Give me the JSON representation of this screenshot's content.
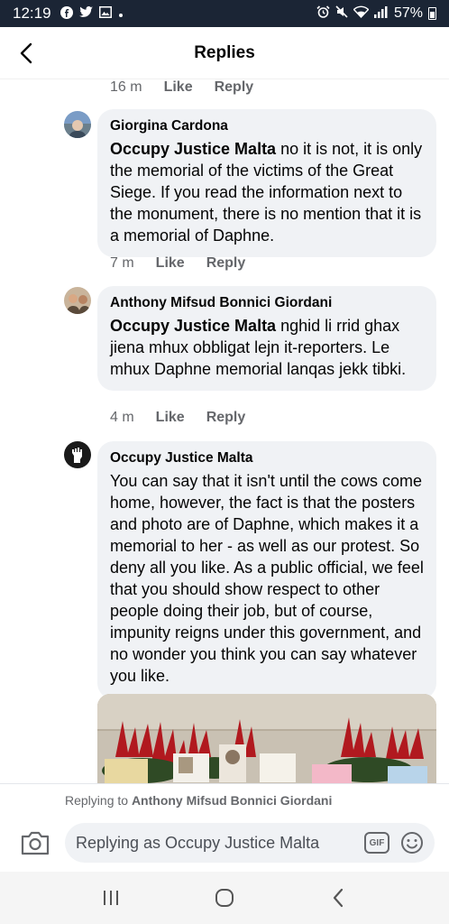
{
  "status_bar": {
    "time": "12:19",
    "battery": "57%",
    "icons": [
      "facebook-icon",
      "twitter-icon",
      "gallery-icon",
      "dot-icon",
      "alarm-icon",
      "mute-icon",
      "wifi-icon",
      "signal-icon",
      "battery-icon"
    ]
  },
  "header": {
    "title": "Replies"
  },
  "top_actions": {
    "time": "16 m",
    "like": "Like",
    "reply": "Reply"
  },
  "comments": [
    {
      "author": "Giorgina Cardona",
      "mention": "Occupy Justice Malta",
      "text": " no it is not, it is only the memorial of the victims of the Great Siege. If you read the information next to the monument, there is no mention that it is a memorial of Daphne.",
      "time": "7 m",
      "like": "Like",
      "reply": "Reply"
    },
    {
      "author": "Anthony Mifsud Bonnici Giordani",
      "mention": "Occupy Justice Malta",
      "text": " nghid li rrid ghax jiena mhux obbligat lejn it-reporters. Le mhux Daphne memorial lanqas jekk tibki.",
      "time": "4 m",
      "like": "Like",
      "reply": "Reply"
    },
    {
      "author": "Occupy Justice Malta",
      "text": "You can say that it isn't until the cows come home, however, the fact is that the posters and photo are of Daphne, which makes it a memorial to her - as well as our protest.  So deny all you like.  As a public official, we feel that you should show respect to other people doing their job, but of course, impunity reigns under this government, and no wonder you think you can say whatever you like."
    }
  ],
  "reply_bar": {
    "replying_to_prefix": "Replying to ",
    "replying_to_name": "Anthony Mifsud Bonnici Giordani",
    "placeholder": "Replying as Occupy Justice Malta",
    "gif_label": "GIF"
  },
  "colors": {
    "status_bar": "#1b2535",
    "bubble": "#f0f2f5",
    "meta_text": "#65676b"
  }
}
